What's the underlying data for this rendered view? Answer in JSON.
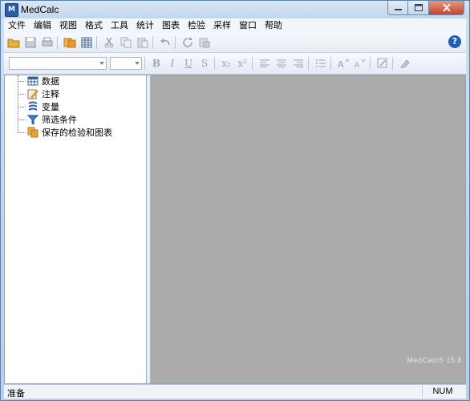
{
  "window": {
    "title": "MedCalc",
    "app_icon_glyph": "M"
  },
  "menu": [
    "文件",
    "编辑",
    "视图",
    "格式",
    "工具",
    "统计",
    "图表",
    "检验",
    "采样",
    "窗口",
    "帮助"
  ],
  "toolbar": {
    "icons": [
      "open-folder-icon",
      "save-icon",
      "print-icon",
      "copy-data-icon",
      "spreadsheet-icon",
      "cut-icon",
      "copy-icon",
      "paste-icon",
      "undo-icon",
      "redo-icon",
      "clipboard-icon"
    ],
    "help_label": "?"
  },
  "format_toolbar": {
    "buttons": [
      {
        "name": "bold-button",
        "label": "B"
      },
      {
        "name": "italic-button",
        "label": "I"
      },
      {
        "name": "underline-button",
        "label": "U"
      },
      {
        "name": "strike-button",
        "label": "S"
      },
      {
        "name": "subscript-button",
        "label": "x₂"
      },
      {
        "name": "superscript-button",
        "label": "x²"
      }
    ]
  },
  "tree": {
    "items": [
      {
        "label": "数据",
        "icon": "table-icon"
      },
      {
        "label": "注释",
        "icon": "note-pencil-icon"
      },
      {
        "label": "变量",
        "icon": "variables-icon"
      },
      {
        "label": "筛选条件",
        "icon": "filter-icon"
      },
      {
        "label": "保存的检验和图表",
        "icon": "saved-charts-icon"
      }
    ]
  },
  "workspace": {
    "watermark": "MedCalc® 15.8"
  },
  "status": {
    "text": "准备",
    "num": "NUM"
  },
  "colors": {
    "workspace_bg": "#ababab",
    "help_blue": "#1f5fb8",
    "close_red": "#c7432b"
  }
}
